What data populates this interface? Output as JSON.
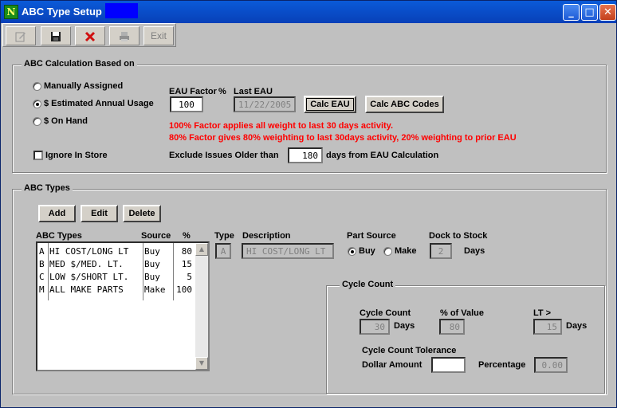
{
  "window": {
    "title": "ABC Type Setup",
    "app_icon": "green-app-icon",
    "controls": [
      "_",
      "□",
      "✕"
    ]
  },
  "toolbar": {
    "exit_label": "Exit",
    "icons": [
      "edit-icon",
      "save-icon",
      "delete-icon",
      "print-icon"
    ]
  },
  "calc_group": {
    "title": "ABC Calculation Based on",
    "radio_manual": "Manually Assigned",
    "radio_eau": "$ Estimated Annual Usage",
    "radio_onhand": "$ On Hand",
    "selected": "$ Estimated Annual Usage",
    "eau_factor_label": "EAU Factor",
    "percent_label": "%",
    "last_eau_label": "Last EAU",
    "eau_factor_value": "100",
    "last_eau_value": "11/22/2005",
    "calc_eau_button": "Calc EAU",
    "calc_abc_button": "Calc ABC Codes",
    "note_line1": "100% Factor applies all weight to last 30 days activity.",
    "note_line2": "80% Factor gives 80% weighting to last 30days activity, 20% weighting to prior EAU",
    "ignore_in_store": "Ignore In Store",
    "exclude_label": "Exclude Issues Older than",
    "exclude_value": "180",
    "exclude_suffix": "days from EAU Calculation"
  },
  "types_group": {
    "title": "ABC Types",
    "add_button": "Add",
    "edit_button": "Edit",
    "delete_button": "Delete",
    "list_headers": {
      "types": "ABC Types",
      "source": "Source",
      "percent": "%"
    },
    "rows": [
      {
        "code": "A",
        "desc": "HI COST/LONG LT",
        "source": "Buy",
        "pct": "80"
      },
      {
        "code": "B",
        "desc": "MED $/MED. LT.",
        "source": "Buy",
        "pct": "15"
      },
      {
        "code": "C",
        "desc": "LOW $/SHORT LT.",
        "source": "Buy",
        "pct": "5"
      },
      {
        "code": "M",
        "desc": "ALL MAKE PARTS",
        "source": "Make",
        "pct": "100"
      }
    ],
    "type_label": "Type",
    "description_label": "Description",
    "type_value": "A",
    "description_value": "HI COST/LONG LT",
    "part_source_label": "Part Source",
    "buy_label": "Buy",
    "make_label": "Make",
    "dock_label": "Dock to Stock",
    "dock_value": "2",
    "days_label": "Days"
  },
  "cycle_group": {
    "title": "Cycle Count",
    "cycle_count_label": "Cycle Count",
    "cycle_count_value": "30",
    "days_label": "Days",
    "pct_value_label": "% of Value",
    "pct_value": "80",
    "lt_label": "LT >",
    "lt_value": "15",
    "lt_days_label": "Days",
    "tolerance_label": "Cycle Count Tolerance",
    "dollar_label": "Dollar Amount",
    "dollar_value": "",
    "percentage_label": "Percentage",
    "percentage_value": "0.00"
  }
}
